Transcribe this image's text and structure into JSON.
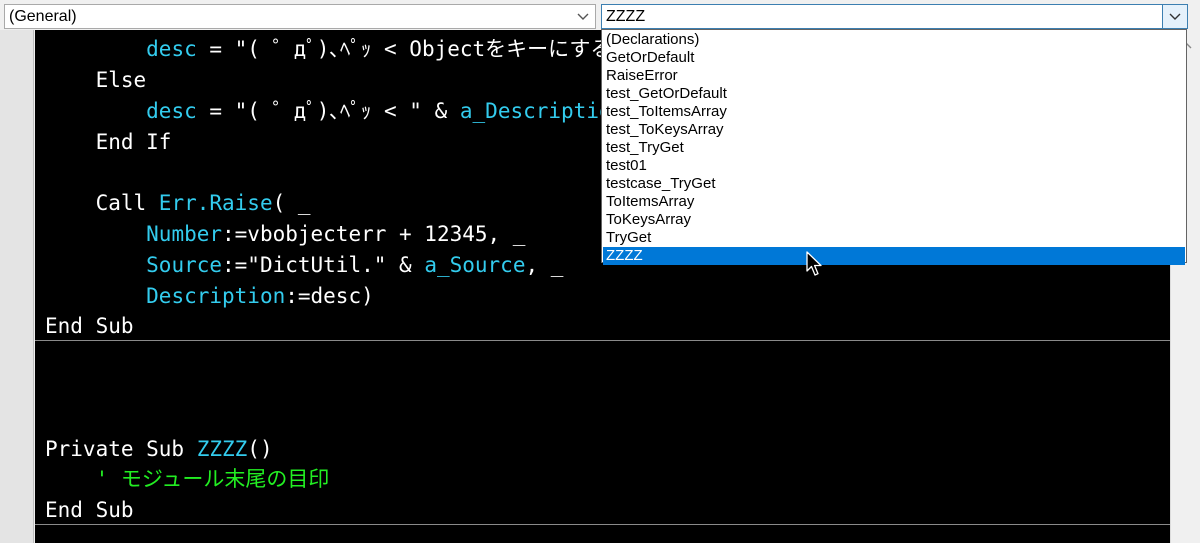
{
  "object_combo": {
    "value": "(General)"
  },
  "proc_combo": {
    "value": "ZZZZ"
  },
  "dropdown": {
    "items": [
      "(Declarations)",
      "GetOrDefault",
      "RaiseError",
      "test_GetOrDefault",
      "test_ToItemsArray",
      "test_ToKeysArray",
      "test_TryGet",
      "test01",
      "testcase_TryGet",
      "ToItemsArray",
      "ToKeysArray",
      "TryGet",
      "ZZZZ"
    ],
    "selected_index": 12
  },
  "code": {
    "l1": {
      "indent": "        ",
      "id": "desc",
      "rest": " = \"( ゜дﾟ)､ﾍﾟｯ < Objectをキーにする"
    },
    "l2": {
      "indent": "    ",
      "kw": "Else"
    },
    "l3": {
      "indent": "        ",
      "id": "desc",
      "mid": " = \"( ゜дﾟ)､ﾍﾟｯ < \" & ",
      "id2": "a_Description"
    },
    "l4": {
      "indent": "    ",
      "kw": "End If"
    },
    "l5": {
      "indent": "    ",
      "kw": "Call ",
      "id": "Err.Raise",
      "rest": "( _"
    },
    "l6": {
      "indent": "        ",
      "id": "Number",
      "mid": ":=vbobjecterr + 12345, _"
    },
    "l7": {
      "indent": "        ",
      "id": "Source",
      "mid": ":=\"DictUtil.\" & ",
      "id2": "a_Source",
      "rest": ", _"
    },
    "l8": {
      "indent": "        ",
      "id": "Description",
      "mid": ":=desc)"
    },
    "l9": {
      "kw": "End Sub"
    },
    "l10": {
      "kw": "Private Sub ",
      "id": "ZZZZ",
      "rest": "()"
    },
    "l11": {
      "indent": "    ",
      "comment": "' モジュール末尾の目印"
    },
    "l12": {
      "kw": "End Sub"
    }
  },
  "colors": {
    "code_background": "#000000",
    "identifier": "#33ccee",
    "comment": "#22ee22",
    "selection": "#0078d7"
  },
  "icons": [
    "chevron-down-icon",
    "scroll-up-arrow-icon",
    "mouse-pointer-icon"
  ]
}
